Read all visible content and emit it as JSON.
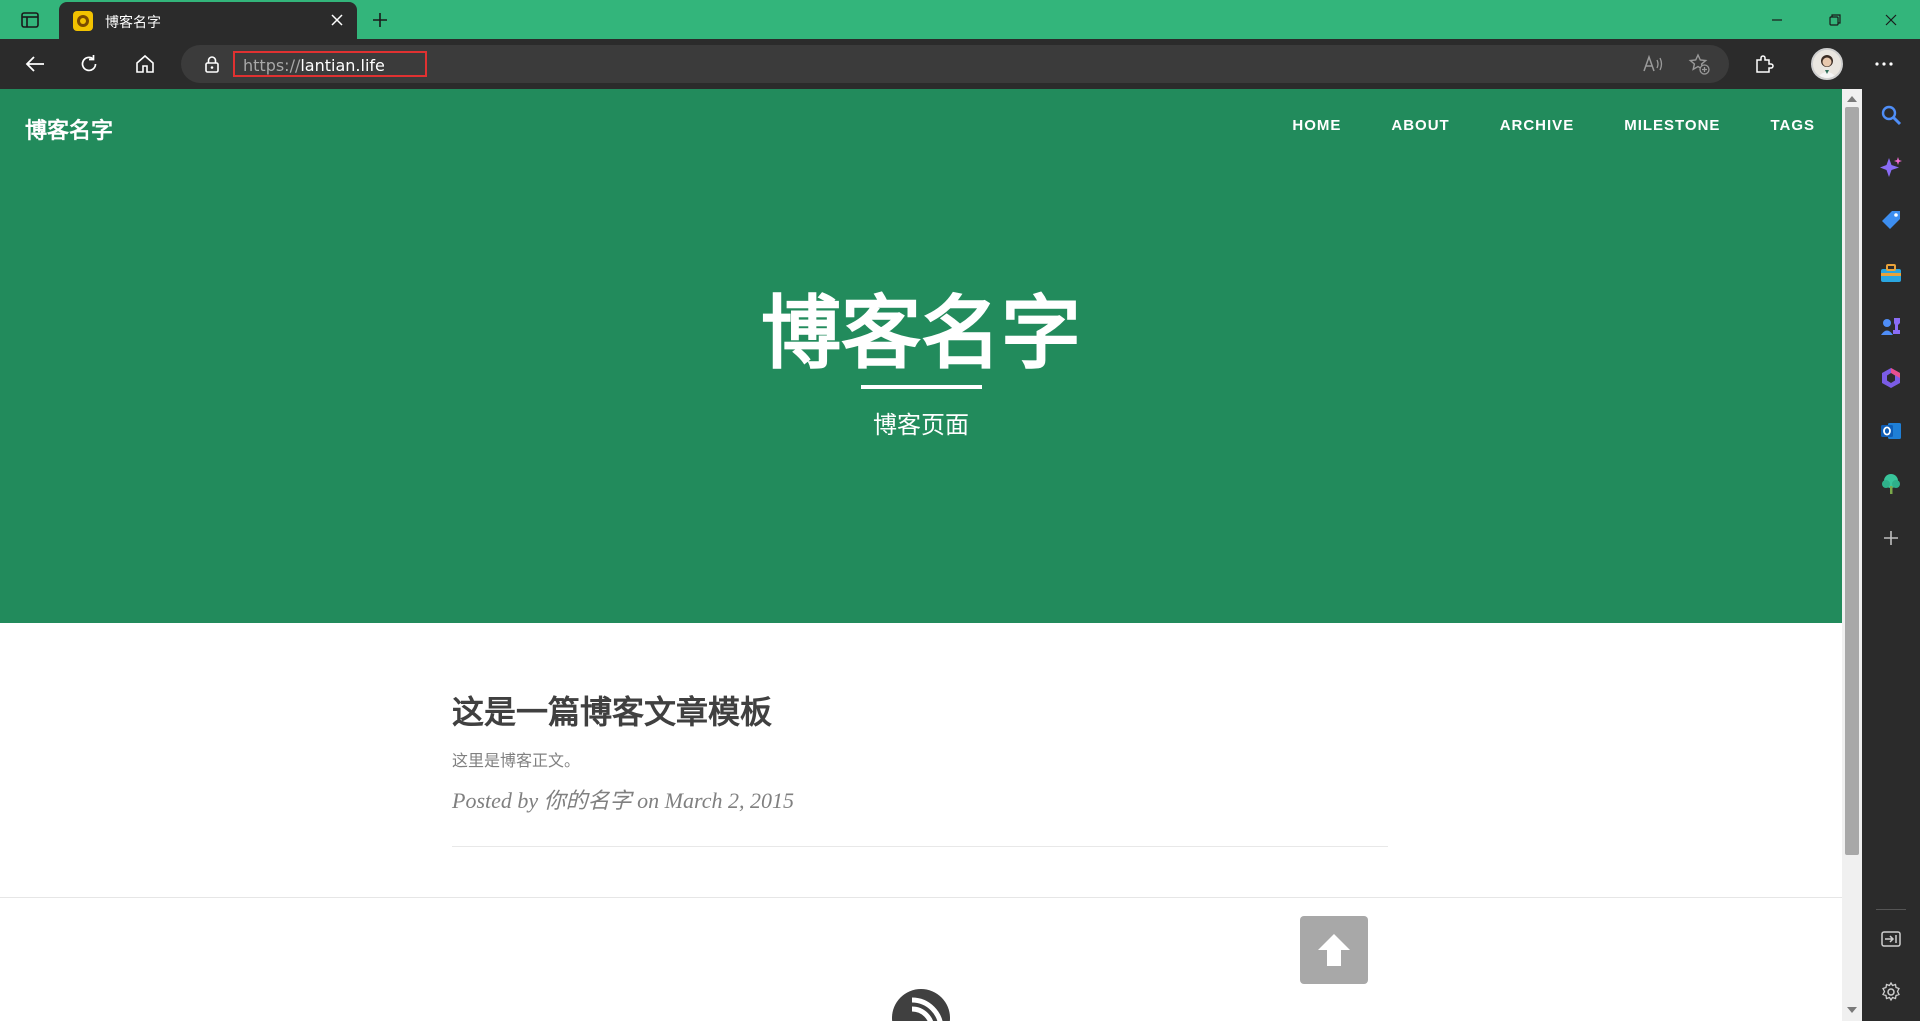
{
  "browser": {
    "tab": {
      "title": "博客名字"
    },
    "url": {
      "scheme": "https://",
      "host": "lantian.life"
    }
  },
  "site": {
    "brand": "博客名字",
    "nav": [
      "HOME",
      "ABOUT",
      "ARCHIVE",
      "MILESTONE",
      "TAGS"
    ],
    "hero": {
      "title": "博客名字",
      "subtitle": "博客页面"
    },
    "post": {
      "title": "这是一篇博客文章模板",
      "subtitle": "这里是博客正文。",
      "meta_prefix": "Posted by ",
      "author": "你的名字",
      "meta_on": " on ",
      "date": "March 2, 2015"
    }
  },
  "colors": {
    "tab_strip": "#33b57b",
    "hero": "#228b5c",
    "toolbar": "#2b2b2b",
    "url_highlight": "#e03131"
  },
  "icons": {
    "sidebar": [
      "search-icon",
      "copilot-icon",
      "shopping-tag-icon",
      "tools-icon",
      "games-icon",
      "office-icon",
      "outlook-icon",
      "tree-icon",
      "add-icon"
    ],
    "sidebar_bottom": [
      "hide-sidebar-icon",
      "settings-icon"
    ]
  }
}
